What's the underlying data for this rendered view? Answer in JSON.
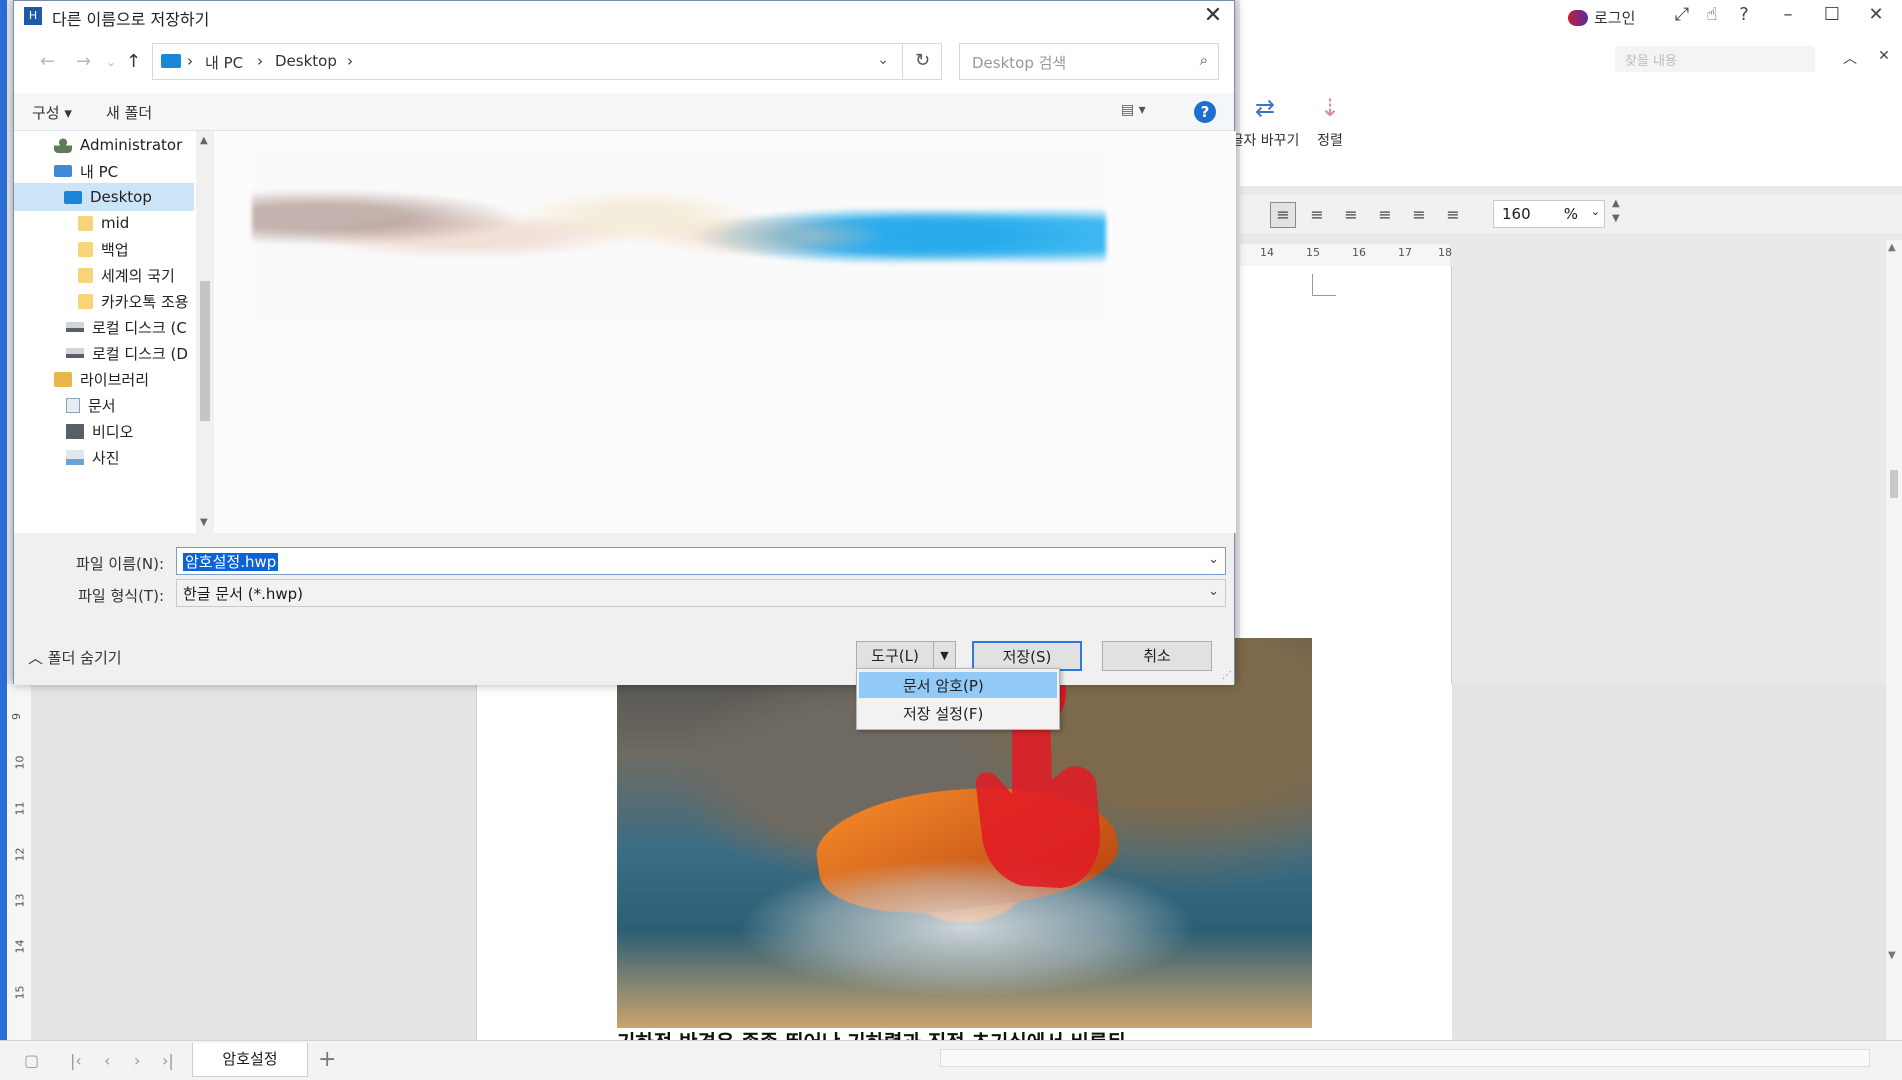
{
  "dialog": {
    "title": "다른 이름으로 저장하기",
    "app_icon": "hwp-app-icon",
    "close_glyph": "✕",
    "address": {
      "crumbs": [
        "내 PC",
        "Desktop"
      ],
      "separator": "›"
    },
    "search_placeholder": "Desktop 검색",
    "toolbar": {
      "organize_label": "구성 ▾",
      "new_folder_label": "새 폴더",
      "help_label": "?"
    },
    "tree": [
      {
        "label": "Administrator",
        "icon": "user-icon"
      },
      {
        "label": "내 PC",
        "icon": "pc-icon"
      },
      {
        "label": "Desktop",
        "icon": "desktop-icon",
        "selected": true
      },
      {
        "label": "mid",
        "icon": "folder-icon"
      },
      {
        "label": "백업",
        "icon": "folder-icon"
      },
      {
        "label": "세계의 국기",
        "icon": "folder-icon"
      },
      {
        "label": "카카오톡 조용",
        "icon": "folder-icon"
      },
      {
        "label": "로컬 디스크 (C",
        "icon": "drive-icon"
      },
      {
        "label": "로컬 디스크 (D",
        "icon": "drive-icon"
      },
      {
        "label": "라이브러리",
        "icon": "library-icon"
      },
      {
        "label": "문서",
        "icon": "document-icon"
      },
      {
        "label": "비디오",
        "icon": "video-icon"
      },
      {
        "label": "사진",
        "icon": "picture-icon"
      }
    ],
    "filename_label": "파일 이름(N):",
    "filename_value": "암호설정.hwp",
    "filetype_label": "파일 형식(T):",
    "filetype_value": "한글 문서 (*.hwp)",
    "hide_folders_label": "폴더 숨기기",
    "tools_label": "도구(L)",
    "save_label": "저장(S)",
    "cancel_label": "취소",
    "tools_menu": [
      {
        "label": "문서 암호(P)",
        "highlighted": true
      },
      {
        "label": "저장 설정(F)",
        "highlighted": false
      }
    ]
  },
  "app": {
    "login_label": "로그인",
    "search_dropdown_label": "찾을 내용",
    "ribbon": {
      "replace_label": "글자 바꾸기",
      "sort_label": "정렬"
    },
    "zoom_value": "160",
    "zoom_unit": "%",
    "ruler_ticks": [
      "14",
      "15",
      "16",
      "17",
      "18"
    ],
    "vruler_ticks": [
      "9",
      "10",
      "11",
      "12",
      "13",
      "14",
      "15"
    ],
    "sheet_tab_label": "암호설정",
    "doc_text": "기하적 반경은 종종 뛰어난 기하렬과 직접 초기실에서 비롯된",
    "accent_color": "#2b6fd6"
  }
}
